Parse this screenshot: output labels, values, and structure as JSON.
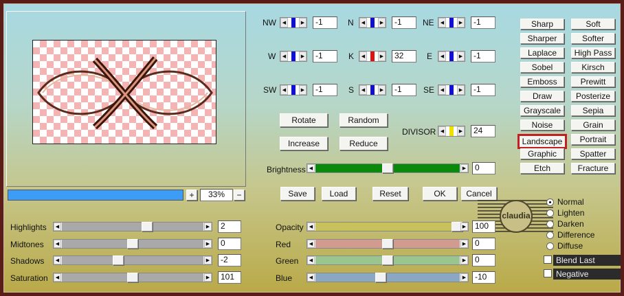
{
  "preview": {
    "zoom": "33%",
    "zoom_in": "+",
    "zoom_out": "−"
  },
  "kernel": {
    "labels": {
      "nw": "NW",
      "n": "N",
      "ne": "NE",
      "w": "W",
      "k": "K",
      "e": "E",
      "sw": "SW",
      "s": "S",
      "se": "SE"
    },
    "values": {
      "nw": "-1",
      "n": "-1",
      "ne": "-1",
      "w": "-1",
      "k": "32",
      "e": "-1",
      "sw": "-1",
      "s": "-1",
      "se": "-1"
    },
    "divisor_label": "DIVISOR",
    "divisor": "24"
  },
  "buttons": {
    "rotate": "Rotate",
    "random": "Random",
    "increase": "Increase",
    "reduce": "Reduce",
    "save": "Save",
    "load": "Load",
    "reset": "Reset",
    "ok": "OK",
    "cancel": "Cancel"
  },
  "brightness": {
    "label": "Brightness",
    "value": "0",
    "level_percent": 50
  },
  "presets": {
    "left": [
      "Sharp",
      "Sharper",
      "Laplace",
      "Sobel",
      "Emboss",
      "Draw",
      "Grayscale",
      "Noise",
      "Landscape",
      "Graphic",
      "Etch"
    ],
    "right": [
      "Soft",
      "Softer",
      "High Pass",
      "Kirsch",
      "Prewitt",
      "Posterize",
      "Sepia",
      "Grain",
      "Portrait",
      "Spatter",
      "Fracture"
    ],
    "selected": "Landscape"
  },
  "tone": [
    {
      "label": "Highlights",
      "value": "2",
      "level_percent": 60
    },
    {
      "label": "Midtones",
      "value": "0",
      "level_percent": 50
    },
    {
      "label": "Shadows",
      "value": "-2",
      "level_percent": 40
    },
    {
      "label": "Saturation",
      "value": "101",
      "level_percent": 50
    }
  ],
  "color": [
    {
      "label": "Opacity",
      "value": "100",
      "level_percent": 98,
      "color": "#c8c25c"
    },
    {
      "label": "Red",
      "value": "0",
      "level_percent": 50,
      "color": "#d39a90"
    },
    {
      "label": "Green",
      "value": "0",
      "level_percent": 50,
      "color": "#9ac58e"
    },
    {
      "label": "Blue",
      "value": "-10",
      "level_percent": 45,
      "color": "#8aa8c4"
    }
  ],
  "blend": {
    "modes": [
      "Normal",
      "Lighten",
      "Darken",
      "Difference",
      "Diffuse"
    ],
    "selected": "Normal",
    "blend_last": "Blend Last",
    "negative": "Negative"
  },
  "watermark": "claudia",
  "colors": {
    "brightness_track": "#0a8a0a",
    "progress": "#3d9cf5",
    "highlight_border": "#c0201f",
    "center_knob": "#e01010",
    "divisor_knob": "#f0e000",
    "knob": "#1010d0"
  }
}
